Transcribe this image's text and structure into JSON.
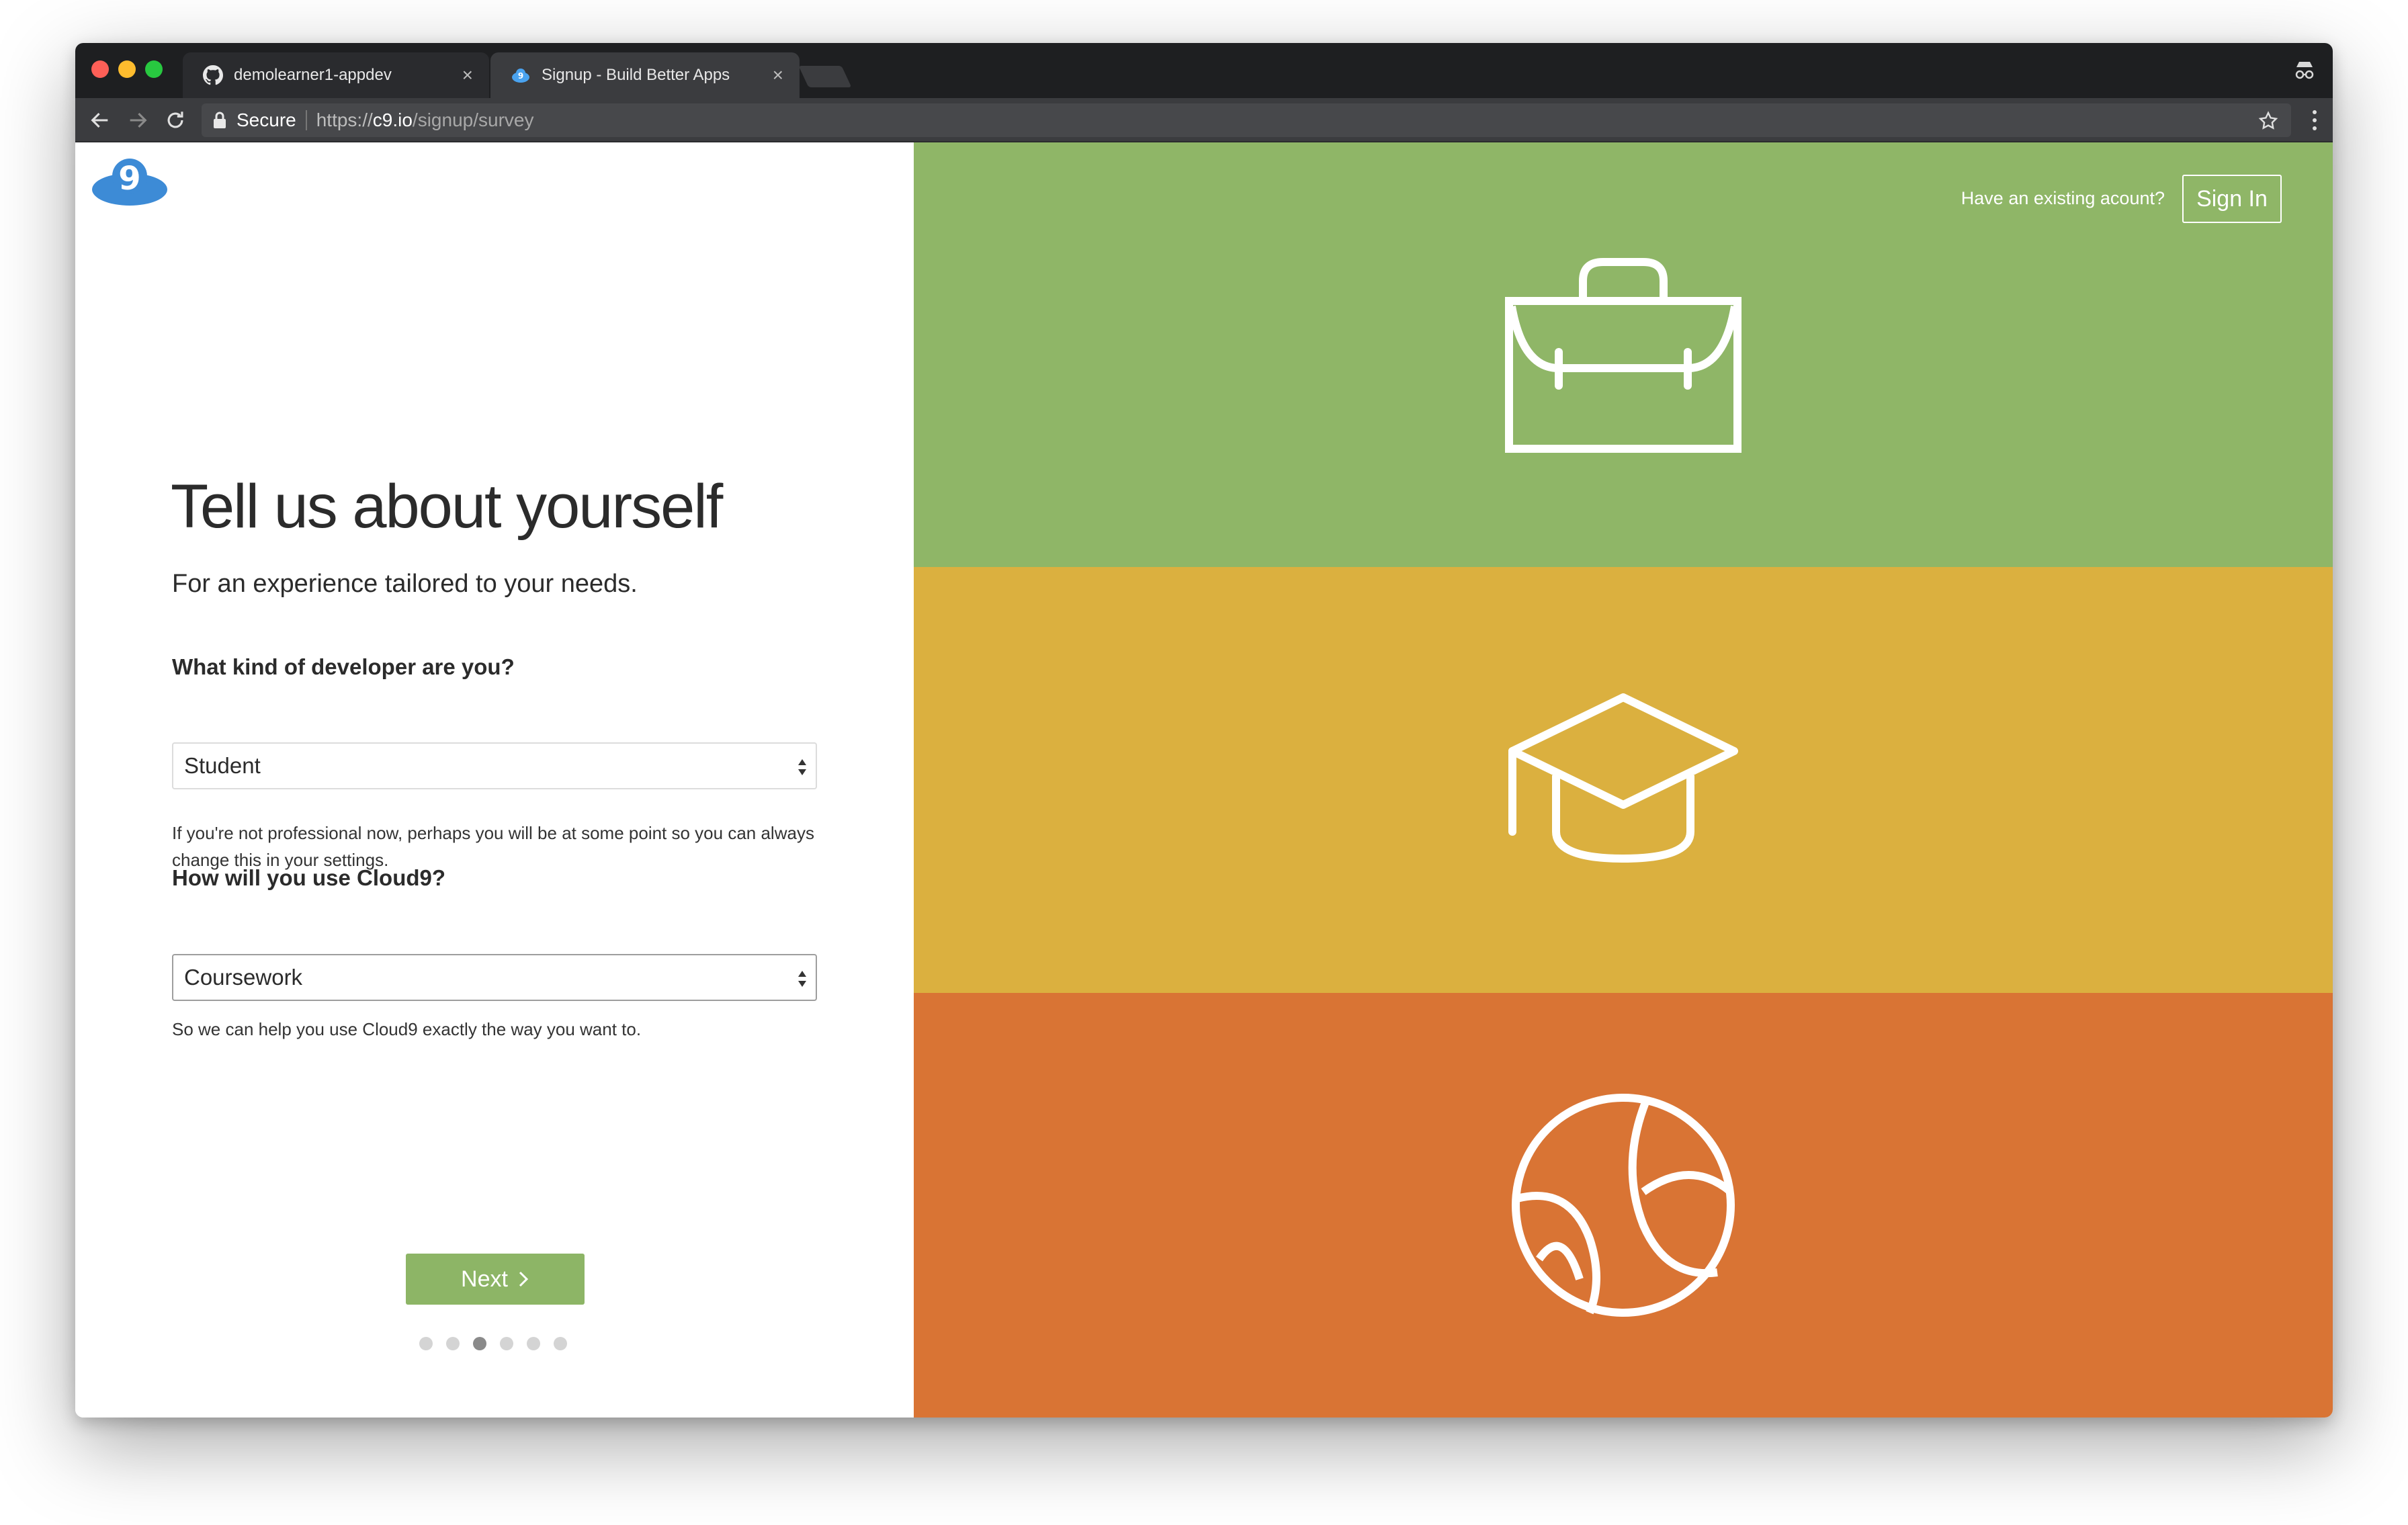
{
  "browser": {
    "tabs": [
      {
        "title": "demolearner1-appdev",
        "icon": "github-icon",
        "active": false
      },
      {
        "title": "Signup - Build Better Apps",
        "icon": "cloud9-icon",
        "active": true
      }
    ],
    "address": {
      "secure_label": "Secure",
      "url_scheme": "https://",
      "url_host": "c9.io",
      "url_path": "/signup/survey"
    }
  },
  "page": {
    "headline": "Tell us about yourself",
    "subheadline": "For an experience tailored to your needs.",
    "question1": {
      "label": "What kind of developer are you?",
      "selected": "Student",
      "help": "If you're not professional now, perhaps you will be at some point so you can always change this in your settings."
    },
    "question2": {
      "label": "How will you use Cloud9?",
      "selected": "Coursework",
      "help": "So we can help you use Cloud9 exactly the way you want to."
    },
    "next_label": "Next",
    "progress": {
      "steps": 6,
      "current": 3
    },
    "account_prompt": "Have an existing acount?",
    "signin_label": "Sign In"
  },
  "colors": {
    "green_band": "#8fb667",
    "yellow_band": "#dbb03f",
    "orange_band": "#d97434",
    "next_button": "#8db566",
    "logo_blue": "#3d8bd6"
  },
  "icons": {
    "professional": "briefcase-icon",
    "student": "graduation-cap-icon",
    "hobby": "basketball-icon"
  }
}
